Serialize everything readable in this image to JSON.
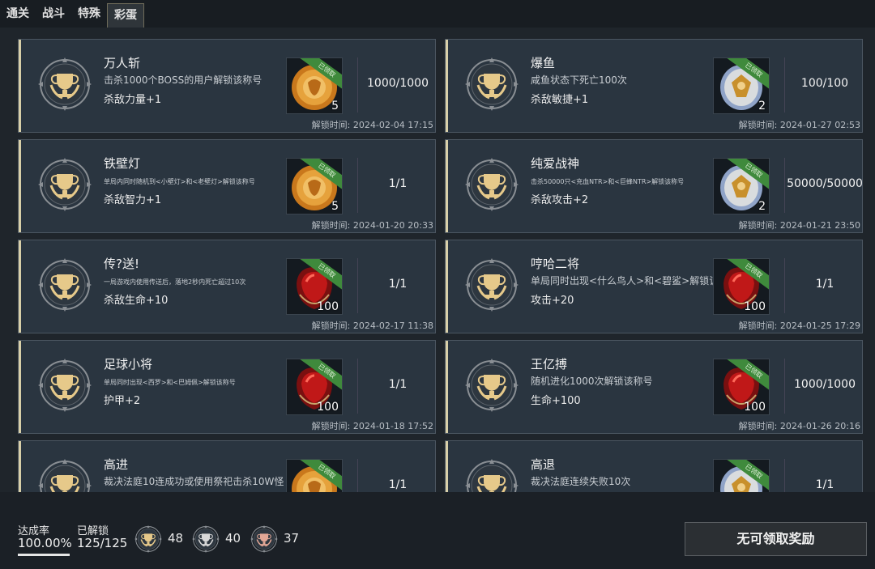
{
  "tabs": [
    "通关",
    "战斗",
    "特殊",
    "彩蛋"
  ],
  "active_tab_index": 3,
  "unlock_prefix": "解锁时间:",
  "ribbon_label": "已领取",
  "achievements": [
    {
      "name": "万人斩",
      "desc": "击杀1000个BOSS的用户解锁该称号",
      "desc_small": false,
      "reward": "杀敌力量+1",
      "item": "orange-medal",
      "qty": "5",
      "progress": "1000/1000",
      "time": "2024-02-04 17:15"
    },
    {
      "name": "爆鱼",
      "desc": "咸鱼状态下死亡100次",
      "desc_small": false,
      "reward": "杀敌敏捷+1",
      "item": "silver-medal",
      "qty": "2",
      "progress": "100/100",
      "time": "2024-01-27 02:53"
    },
    {
      "name": "铁壁灯",
      "desc": "单局内同时随机到<小壁灯>和<老壁灯>解锁该称号",
      "desc_small": true,
      "reward": "杀敌智力+1",
      "item": "orange-medal",
      "qty": "5",
      "progress": "1/1",
      "time": "2024-01-20 20:33"
    },
    {
      "name": "纯爱战神",
      "desc": "击杀50000只<充血NTR>和<巨蜂NTR>解锁该称号",
      "desc_small": true,
      "reward": "杀敌攻击+2",
      "item": "silver-medal",
      "qty": "2",
      "progress": "50000/50000",
      "time": "2024-01-21 23:50"
    },
    {
      "name": "传?送!",
      "desc": "一局游戏内使用传送后，落地2秒内死亡超过10次",
      "desc_small": true,
      "reward": "杀敌生命+10",
      "item": "red-gem",
      "qty": "100",
      "progress": "1/1",
      "time": "2024-02-17 11:38"
    },
    {
      "name": "哼哈二将",
      "desc": "单局同时出现<什么鸟人>和<碧鲨>解锁该称号",
      "desc_small": false,
      "reward": "攻击+20",
      "item": "red-gem",
      "qty": "100",
      "progress": "1/1",
      "time": "2024-01-25 17:29"
    },
    {
      "name": "足球小将",
      "desc": "单局同时出现<西罗>和<巴姆佩>解锁该称号",
      "desc_small": true,
      "reward": "护甲+2",
      "item": "red-gem",
      "qty": "100",
      "progress": "1/1",
      "time": "2024-01-18 17:52"
    },
    {
      "name": "王亿搏",
      "desc": "随机进化1000次解锁该称号",
      "desc_small": false,
      "reward": "生命+100",
      "item": "red-gem",
      "qty": "100",
      "progress": "1000/1000",
      "time": "2024-01-26 20:16"
    },
    {
      "name": "高进",
      "desc": "裁决法庭10连成功或使用祭祀击杀10W怪",
      "desc_small": false,
      "reward": "",
      "item": "orange-medal",
      "qty": "",
      "progress": "1/1",
      "time": ""
    },
    {
      "name": "高退",
      "desc": "裁决法庭连续失败10次",
      "desc_small": false,
      "reward": "",
      "item": "silver-medal",
      "qty": "",
      "progress": "1/1",
      "time": ""
    }
  ],
  "footer": {
    "completion_label": "达成率",
    "completion_value": "100.00%",
    "completion_fraction": 1.0,
    "unlocked_label": "已解锁",
    "unlocked_value": "125/125",
    "gold_count": "48",
    "silver_count": "40",
    "bronze_count": "37",
    "claim_button": "无可领取奖励"
  },
  "colors": {
    "gold": "#e6c98a",
    "silver": "#d8d8d8",
    "bronze": "#e2a796",
    "ribbon": "#3f8a3c"
  }
}
